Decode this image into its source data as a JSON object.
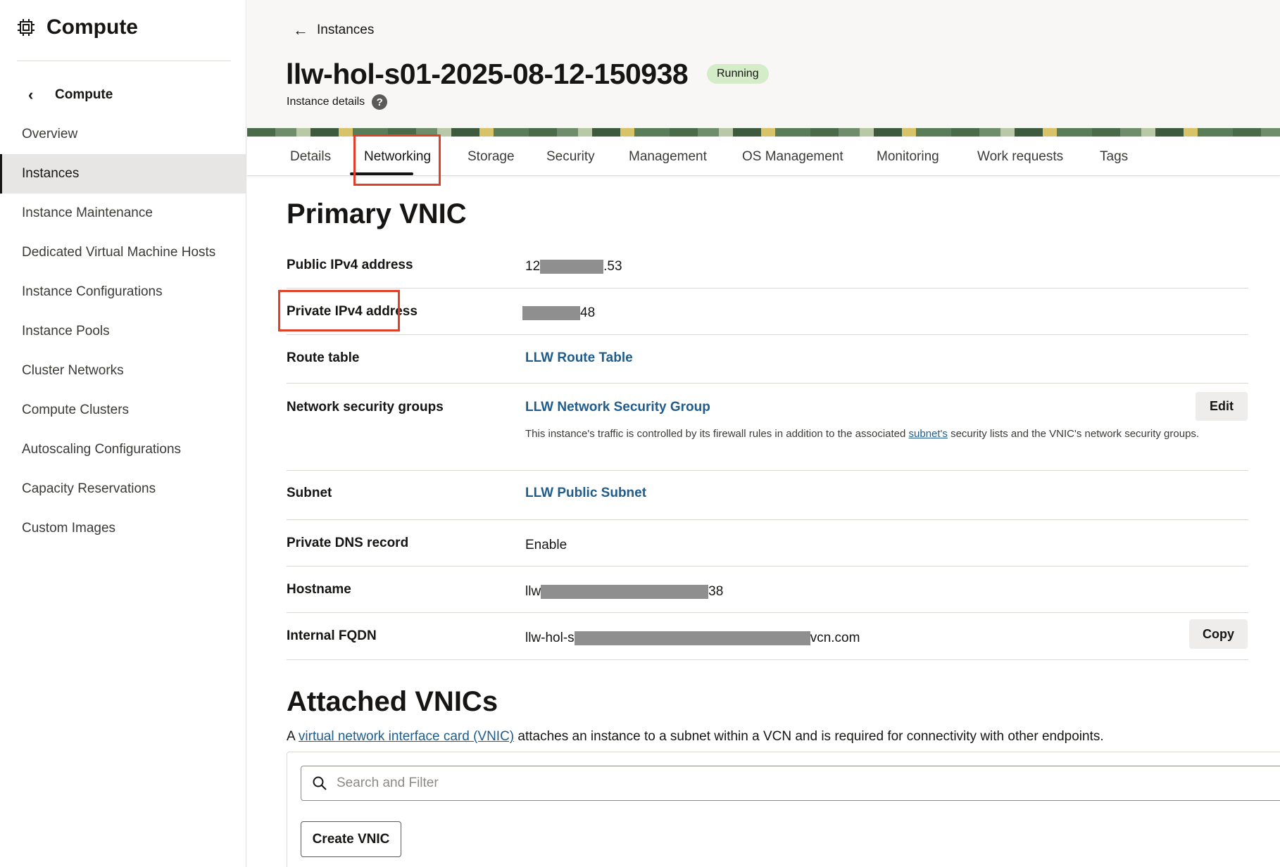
{
  "sidebar": {
    "title": "Compute",
    "back_label": "Compute",
    "items": [
      {
        "label": "Overview"
      },
      {
        "label": "Instances"
      },
      {
        "label": "Instance Maintenance"
      },
      {
        "label": "Dedicated Virtual Machine Hosts"
      },
      {
        "label": "Instance Configurations"
      },
      {
        "label": "Instance Pools"
      },
      {
        "label": "Cluster Networks"
      },
      {
        "label": "Compute Clusters"
      },
      {
        "label": "Autoscaling Configurations"
      },
      {
        "label": "Capacity Reservations"
      },
      {
        "label": "Custom Images"
      }
    ],
    "active_item": "Instances"
  },
  "header": {
    "back_label": "Instances",
    "title": "llw-hol-s01-2025-08-12-150938",
    "status": "Running",
    "subtitle": "Instance details",
    "help_icon": "?"
  },
  "tabs": [
    {
      "label": "Details"
    },
    {
      "label": "Networking"
    },
    {
      "label": "Storage"
    },
    {
      "label": "Security"
    },
    {
      "label": "Management"
    },
    {
      "label": "OS Management"
    },
    {
      "label": "Monitoring"
    },
    {
      "label": "Work requests"
    },
    {
      "label": "Tags"
    }
  ],
  "active_tab": "Networking",
  "primary_vnic": {
    "heading": "Primary VNIC",
    "public_ip": {
      "label": "Public IPv4 address",
      "prefix": "12",
      "suffix": ".53"
    },
    "private_ip": {
      "label": "Private IPv4 address",
      "prefix": "",
      "suffix": "48"
    },
    "route_table": {
      "label": "Route table",
      "value": "LLW Route Table"
    },
    "nsg": {
      "label": "Network security groups",
      "value": "LLW Network Security Group",
      "note_before": "This instance's traffic is controlled by its firewall rules in addition to the associated ",
      "note_link": "subnet's",
      "note_after": " security lists and the VNIC's network security groups.",
      "edit_label": "Edit"
    },
    "subnet": {
      "label": "Subnet",
      "value": "LLW Public Subnet"
    },
    "dns": {
      "label": "Private DNS record",
      "value": "Enable"
    },
    "hostname": {
      "label": "Hostname",
      "prefix": "llw",
      "suffix": "38"
    },
    "fqdn": {
      "label": "Internal FQDN",
      "prefix": "llw-hol-s",
      "suffix": "vcn.com",
      "copy_label": "Copy"
    }
  },
  "attached": {
    "heading": "Attached VNICs",
    "desc_before": "A ",
    "desc_link": "virtual network interface card (VNIC)",
    "desc_after": " attaches an instance to a subnet within a VCN and is required for connectivity with other endpoints.",
    "search_placeholder": "Search and Filter",
    "create_label": "Create VNIC"
  },
  "colors": {
    "link": "#1f5c8c",
    "highlight": "#e0402a",
    "status_bg": "#d4edc8"
  }
}
